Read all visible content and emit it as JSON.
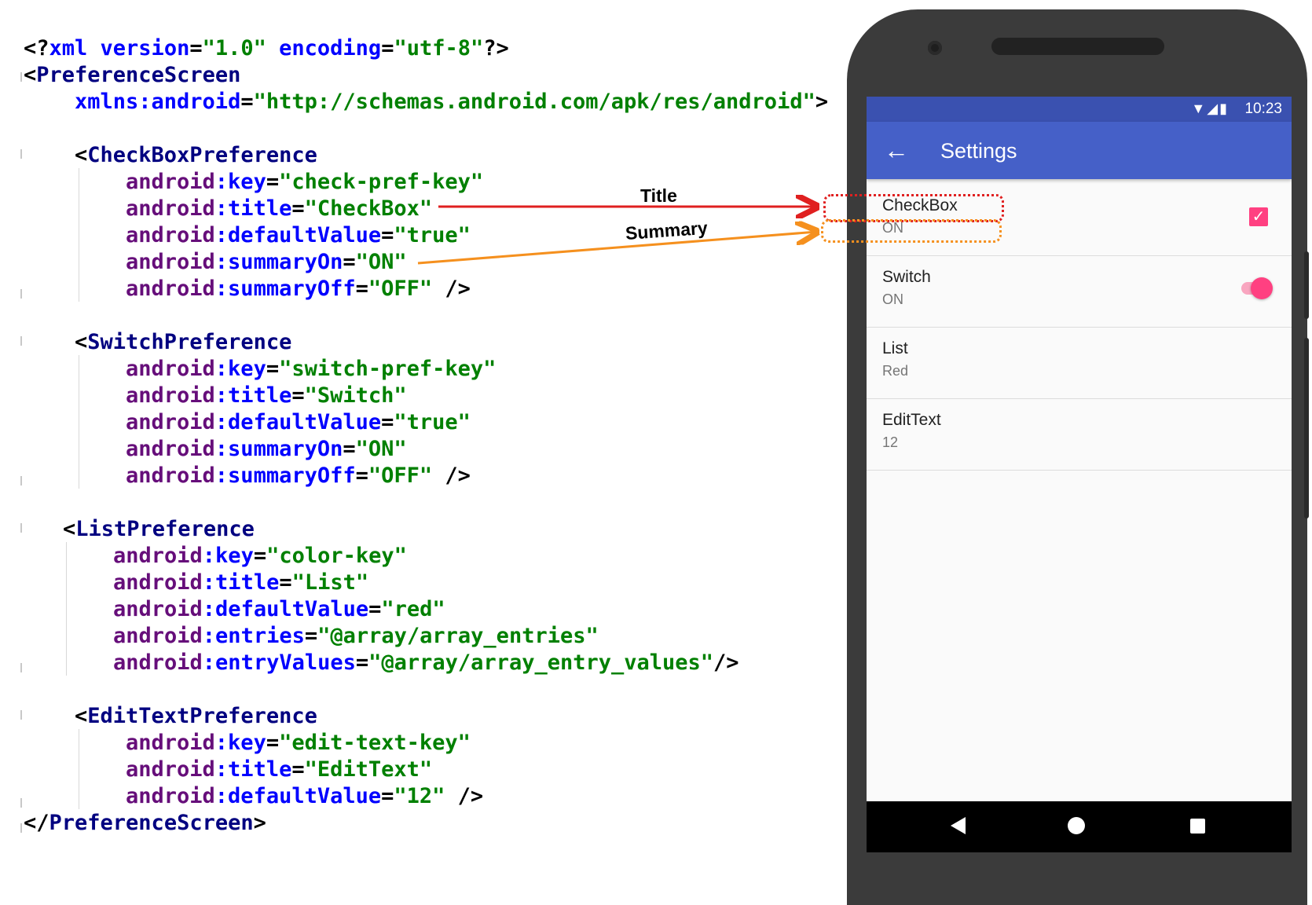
{
  "code": {
    "lines": [
      [
        {
          "c": "p",
          "t": "<?"
        },
        {
          "c": "a",
          "t": "xml version"
        },
        {
          "c": "p",
          "t": "="
        },
        {
          "c": "s",
          "t": "\"1.0\""
        },
        {
          "c": "p",
          "t": " "
        },
        {
          "c": "a",
          "t": "encoding"
        },
        {
          "c": "p",
          "t": "="
        },
        {
          "c": "s",
          "t": "\"utf-8\""
        },
        {
          "c": "p",
          "t": "?>"
        }
      ],
      [
        {
          "c": "p",
          "t": "<"
        },
        {
          "c": "t",
          "t": "PreferenceScreen"
        }
      ],
      [
        {
          "c": "a",
          "t": "xmlns:android"
        },
        {
          "c": "p",
          "t": "="
        },
        {
          "c": "s",
          "t": "\"http://schemas.android.com/apk/res/android\""
        },
        {
          "c": "p",
          "t": ">"
        }
      ],
      [
        {
          "c": "p",
          "t": "<"
        },
        {
          "c": "t",
          "t": "CheckBoxPreference"
        }
      ],
      [
        {
          "c": "ns",
          "t": "android"
        },
        {
          "c": "a",
          "t": ":key"
        },
        {
          "c": "p",
          "t": "="
        },
        {
          "c": "s",
          "t": "\"check-pref-key\""
        }
      ],
      [
        {
          "c": "ns",
          "t": "android"
        },
        {
          "c": "a",
          "t": ":title"
        },
        {
          "c": "p",
          "t": "="
        },
        {
          "c": "s",
          "t": "\"CheckBox\""
        }
      ],
      [
        {
          "c": "ns",
          "t": "android"
        },
        {
          "c": "a",
          "t": ":defaultValue"
        },
        {
          "c": "p",
          "t": "="
        },
        {
          "c": "s",
          "t": "\"true\""
        }
      ],
      [
        {
          "c": "ns",
          "t": "android"
        },
        {
          "c": "a",
          "t": ":summaryOn"
        },
        {
          "c": "p",
          "t": "="
        },
        {
          "c": "s",
          "t": "\"ON\""
        }
      ],
      [
        {
          "c": "ns",
          "t": "android"
        },
        {
          "c": "a",
          "t": ":summaryOff"
        },
        {
          "c": "p",
          "t": "="
        },
        {
          "c": "s",
          "t": "\"OFF\""
        },
        {
          "c": "p",
          "t": " />"
        }
      ],
      [
        {
          "c": "p",
          "t": "<"
        },
        {
          "c": "t",
          "t": "SwitchPreference"
        }
      ],
      [
        {
          "c": "ns",
          "t": "android"
        },
        {
          "c": "a",
          "t": ":key"
        },
        {
          "c": "p",
          "t": "="
        },
        {
          "c": "s",
          "t": "\"switch-pref-key\""
        }
      ],
      [
        {
          "c": "ns",
          "t": "android"
        },
        {
          "c": "a",
          "t": ":title"
        },
        {
          "c": "p",
          "t": "="
        },
        {
          "c": "s",
          "t": "\"Switch\""
        }
      ],
      [
        {
          "c": "ns",
          "t": "android"
        },
        {
          "c": "a",
          "t": ":defaultValue"
        },
        {
          "c": "p",
          "t": "="
        },
        {
          "c": "s",
          "t": "\"true\""
        }
      ],
      [
        {
          "c": "ns",
          "t": "android"
        },
        {
          "c": "a",
          "t": ":summaryOn"
        },
        {
          "c": "p",
          "t": "="
        },
        {
          "c": "s",
          "t": "\"ON\""
        }
      ],
      [
        {
          "c": "ns",
          "t": "android"
        },
        {
          "c": "a",
          "t": ":summaryOff"
        },
        {
          "c": "p",
          "t": "="
        },
        {
          "c": "s",
          "t": "\"OFF\""
        },
        {
          "c": "p",
          "t": " />"
        }
      ],
      [
        {
          "c": "p",
          "t": "<"
        },
        {
          "c": "t",
          "t": "ListPreference"
        }
      ],
      [
        {
          "c": "ns",
          "t": "android"
        },
        {
          "c": "a",
          "t": ":key"
        },
        {
          "c": "p",
          "t": "="
        },
        {
          "c": "s",
          "t": "\"color-key\""
        }
      ],
      [
        {
          "c": "ns",
          "t": "android"
        },
        {
          "c": "a",
          "t": ":title"
        },
        {
          "c": "p",
          "t": "="
        },
        {
          "c": "s",
          "t": "\"List\""
        }
      ],
      [
        {
          "c": "ns",
          "t": "android"
        },
        {
          "c": "a",
          "t": ":defaultValue"
        },
        {
          "c": "p",
          "t": "="
        },
        {
          "c": "s",
          "t": "\"red\""
        }
      ],
      [
        {
          "c": "ns",
          "t": "android"
        },
        {
          "c": "a",
          "t": ":entries"
        },
        {
          "c": "p",
          "t": "="
        },
        {
          "c": "s",
          "t": "\"@array/array_entries\""
        }
      ],
      [
        {
          "c": "ns",
          "t": "android"
        },
        {
          "c": "a",
          "t": ":entryValues"
        },
        {
          "c": "p",
          "t": "="
        },
        {
          "c": "s",
          "t": "\"@array/array_entry_values\""
        },
        {
          "c": "p",
          "t": "/>"
        }
      ],
      [
        {
          "c": "p",
          "t": "<"
        },
        {
          "c": "t",
          "t": "EditTextPreference"
        }
      ],
      [
        {
          "c": "ns",
          "t": "android"
        },
        {
          "c": "a",
          "t": ":key"
        },
        {
          "c": "p",
          "t": "="
        },
        {
          "c": "s",
          "t": "\"edit-text-key\""
        }
      ],
      [
        {
          "c": "ns",
          "t": "android"
        },
        {
          "c": "a",
          "t": ":title"
        },
        {
          "c": "p",
          "t": "="
        },
        {
          "c": "s",
          "t": "\"EditText\""
        }
      ],
      [
        {
          "c": "ns",
          "t": "android"
        },
        {
          "c": "a",
          "t": ":defaultValue"
        },
        {
          "c": "p",
          "t": "="
        },
        {
          "c": "s",
          "t": "\"12\""
        },
        {
          "c": "p",
          "t": " />"
        }
      ],
      [
        {
          "c": "p",
          "t": "</"
        },
        {
          "c": "t",
          "t": "PreferenceScreen"
        },
        {
          "c": "p",
          "t": ">"
        }
      ]
    ]
  },
  "annotations": {
    "title_label": "Title",
    "summary_label": "Summary",
    "title_color": "#e02020",
    "summary_color": "#f5901e"
  },
  "phone": {
    "status_time": "10:23",
    "status_icons": "▼◢▮",
    "app_title": "Settings",
    "back_icon": "←",
    "preferences": [
      {
        "title": "CheckBox",
        "summary": "ON",
        "widget": "checkbox",
        "checked": true
      },
      {
        "title": "Switch",
        "summary": "ON",
        "widget": "switch",
        "checked": true
      },
      {
        "title": "List",
        "summary": "Red",
        "widget": "none"
      },
      {
        "title": "EditText",
        "summary": "12",
        "widget": "none"
      }
    ],
    "accent_color": "#ff4081",
    "appbar_color": "#4560c8",
    "statusbar_color": "#3a51b0"
  }
}
